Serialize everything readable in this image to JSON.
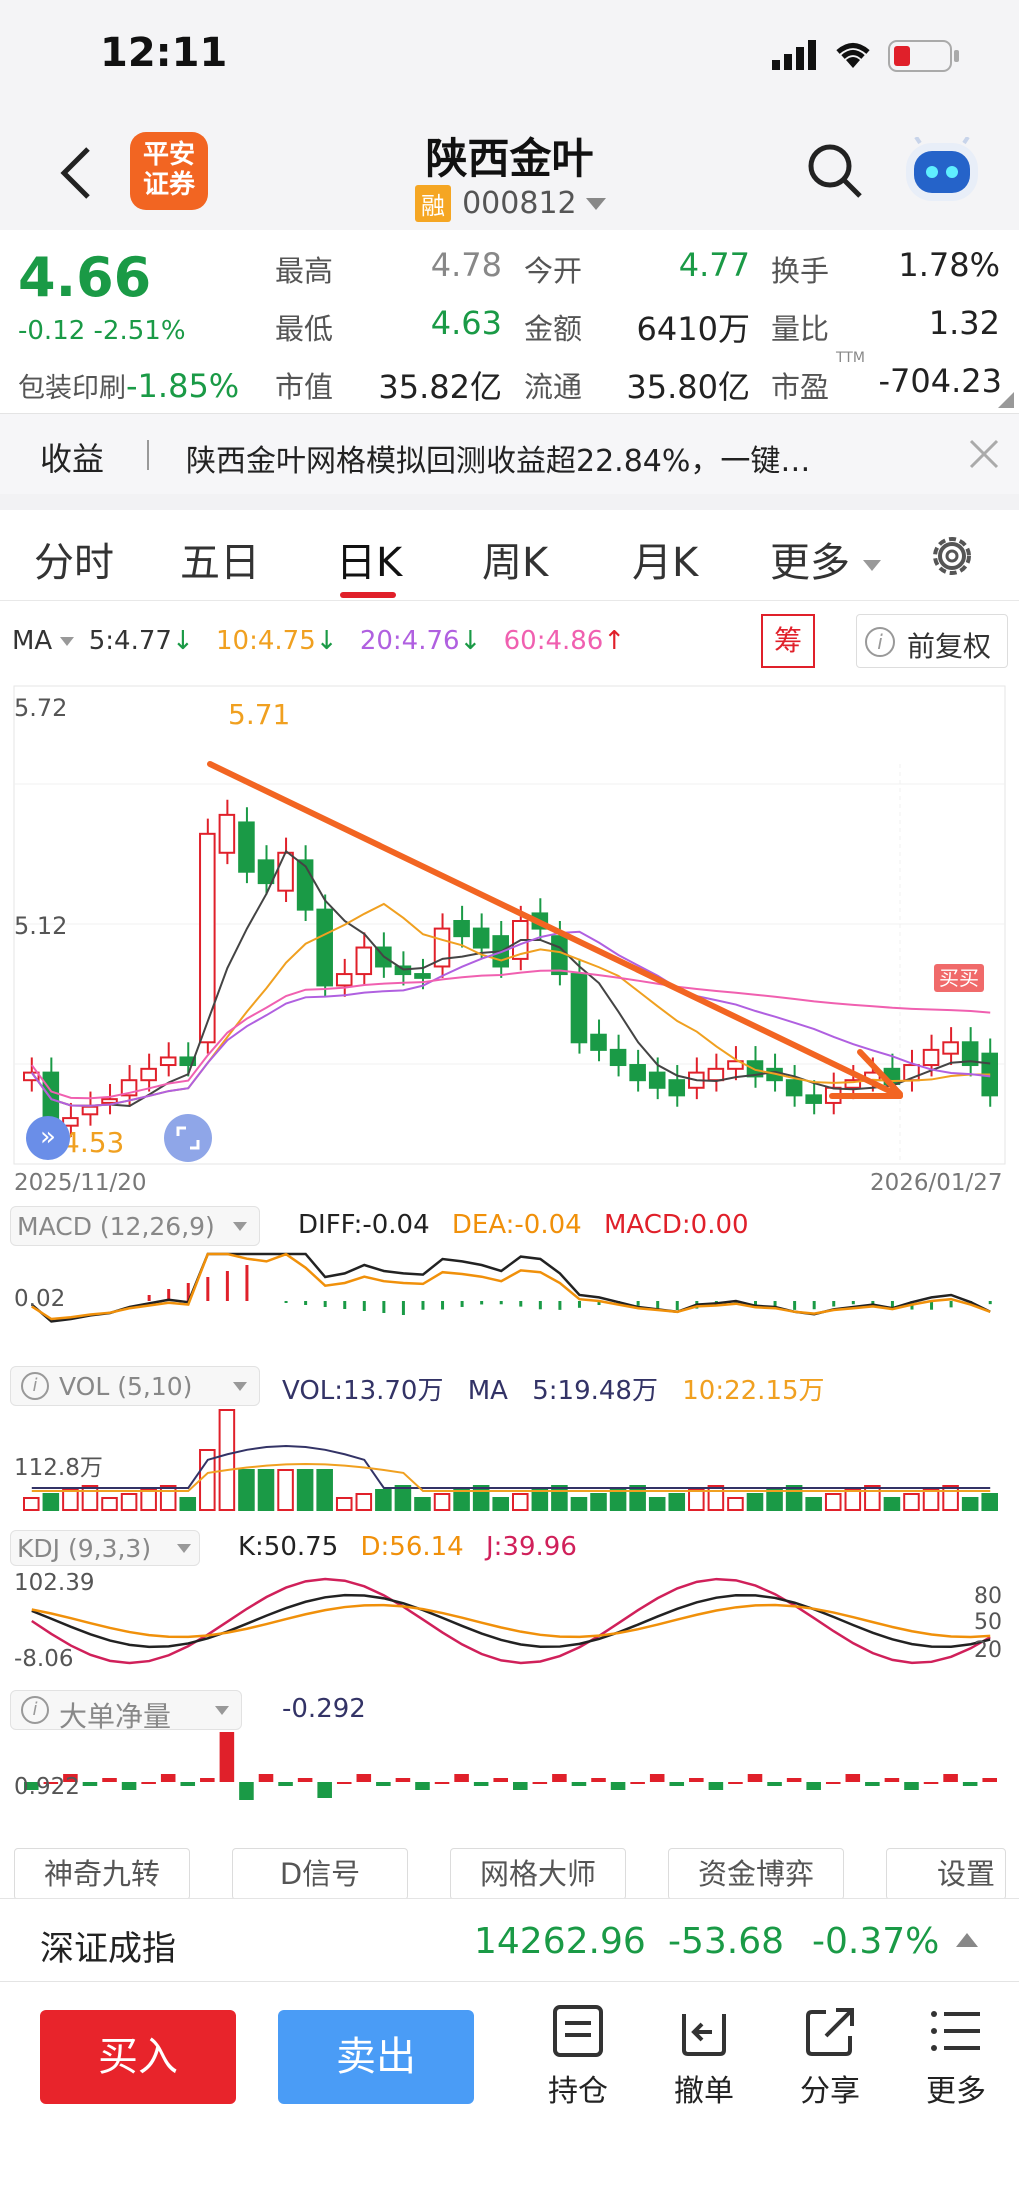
{
  "status": {
    "time": "12:11"
  },
  "header": {
    "logo_line1": "平安",
    "logo_line2": "证券",
    "title": "陕西金叶",
    "badge": "融",
    "code": "000812"
  },
  "quote": {
    "price": "4.66",
    "change": "-0.12",
    "change_pct": "-2.51%",
    "sector_name": "包装印刷",
    "sector_change": "-1.85%",
    "fields": [
      {
        "label": "最高",
        "value": "4.78"
      },
      {
        "label": "今开",
        "value": "4.77"
      },
      {
        "label": "换手",
        "value": "1.78%"
      },
      {
        "label": "最低",
        "value": "4.63"
      },
      {
        "label": "金额",
        "value": "6410万"
      },
      {
        "label": "量比",
        "value": "1.32"
      },
      {
        "label": "市值",
        "value": "35.82亿"
      },
      {
        "label": "流通",
        "value": "35.80亿"
      },
      {
        "label": "市盈",
        "value": "-704.23"
      }
    ],
    "ttm": "TTM"
  },
  "notice": {
    "tag": "收益",
    "text": "陕西金叶网格模拟回测收益超22.84%，一键…"
  },
  "tabs": [
    "分时",
    "五日",
    "日K",
    "周K",
    "月K",
    "更多"
  ],
  "active_tab": "日K",
  "ma_legend": {
    "label": "MA",
    "items": [
      {
        "text": "5:4.77",
        "color": "#333333",
        "arrow": "↓"
      },
      {
        "text": "10:4.75",
        "color": "#f0a020",
        "arrow": "↓"
      },
      {
        "text": "20:4.76",
        "color": "#b060e0",
        "arrow": "↓"
      },
      {
        "text": "60:4.86",
        "color": "#f060b0",
        "arrow": "↑"
      }
    ],
    "chip_btn": "筹",
    "adjust": "前复权"
  },
  "kline": {
    "y_top_label": "5.72",
    "y_mid_label": "5.12",
    "high_label": "5.71",
    "low_label": "4.53",
    "date_start": "2025/11/20",
    "date_end": "2026/01/27",
    "signal": "买买"
  },
  "macd": {
    "name": "MACD (12,26,9)",
    "diff": "DIFF:-0.04",
    "dea": "DEA:-0.04",
    "macd": "MACD:0.00",
    "axis": "0.02"
  },
  "vol": {
    "name": "VOL (5,10)",
    "vol": "VOL:13.70万",
    "ma_label": "MA",
    "ma5": "5:19.48万",
    "ma10": "10:22.15万",
    "axis": "112.8万"
  },
  "kdj": {
    "name": "KDJ (9,3,3)",
    "k": "K:50.75",
    "d": "D:56.14",
    "j": "J:39.96",
    "axis_top": "102.39",
    "axis_bottom": "-8.06",
    "r80": "80",
    "r50": "50",
    "r20": "20"
  },
  "bigorder": {
    "name": "大单净量",
    "value": "-0.292",
    "axis": "0.922"
  },
  "shortcuts": [
    "神奇九转",
    "D信号",
    "网格大师",
    "资金博弈",
    "设置"
  ],
  "index_bar": {
    "name": "深证成指",
    "value": "14262.96",
    "change": "-53.68",
    "pct": "-0.37%"
  },
  "bottom": {
    "buy": "买入",
    "sell": "卖出",
    "positions": "持仓",
    "cancel": "撤单",
    "share": "分享",
    "more": "更多"
  },
  "colors": {
    "up": "#e0202a",
    "down": "#1a9a46",
    "accent": "#ff5a1f"
  }
}
